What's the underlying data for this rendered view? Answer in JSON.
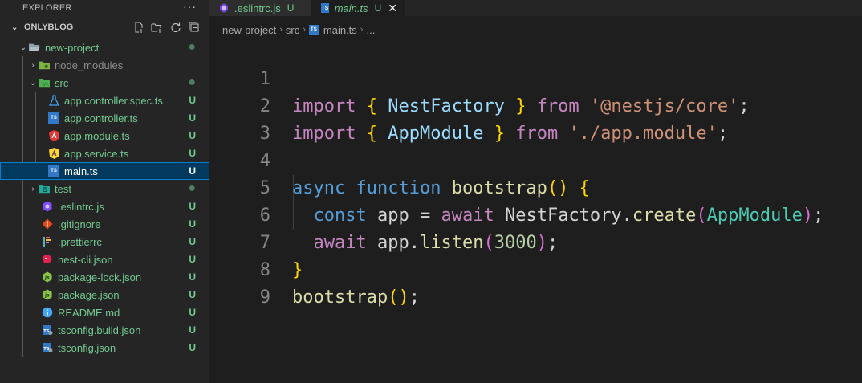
{
  "sidebar": {
    "title": "EXPLORER",
    "more_label": "···",
    "workspace": "ONLYBLOG",
    "actions": [
      "new-file-icon",
      "new-folder-icon",
      "refresh-icon",
      "collapse-all-icon"
    ],
    "items": [
      {
        "label": "new-project",
        "status": "●"
      },
      {
        "label": "node_modules",
        "status": ""
      },
      {
        "label": "src",
        "status": "●"
      },
      {
        "label": "app.controller.spec.ts",
        "status": "U"
      },
      {
        "label": "app.controller.ts",
        "status": "U"
      },
      {
        "label": "app.module.ts",
        "status": "U"
      },
      {
        "label": "app.service.ts",
        "status": "U"
      },
      {
        "label": "main.ts",
        "status": "U"
      },
      {
        "label": "test",
        "status": "●"
      },
      {
        "label": ".eslintrc.js",
        "status": "U"
      },
      {
        "label": ".gitignore",
        "status": "U"
      },
      {
        "label": ".prettierrc",
        "status": "U"
      },
      {
        "label": "nest-cli.json",
        "status": "U"
      },
      {
        "label": "package-lock.json",
        "status": "U"
      },
      {
        "label": "package.json",
        "status": "U"
      },
      {
        "label": "README.md",
        "status": "U"
      },
      {
        "label": "tsconfig.build.json",
        "status": "U"
      },
      {
        "label": "tsconfig.json",
        "status": "U"
      }
    ]
  },
  "tabs": [
    {
      "name": ".eslintrc.js",
      "status": "U",
      "icon": "eslint-icon"
    },
    {
      "name": "main.ts",
      "status": "U",
      "icon": "typescript-icon",
      "close": "✕"
    }
  ],
  "breadcrumb": {
    "parts": [
      "new-project",
      "src",
      "main.ts",
      "..."
    ]
  },
  "editor": {
    "line_numbers": [
      "1",
      "2",
      "3",
      "4",
      "5",
      "6",
      "7",
      "8",
      "9"
    ],
    "tokens": {
      "l1": [
        "import",
        "{",
        "NestFactory",
        "}",
        "from",
        "'@nestjs/core'",
        ";"
      ],
      "l2": [
        "import",
        "{",
        "AppModule",
        "}",
        "from",
        "'./app.module'",
        ";"
      ],
      "l4": [
        "async",
        "function",
        "bootstrap",
        "()",
        "{"
      ],
      "l5": [
        "const",
        "app",
        "=",
        "await",
        "NestFactory",
        ".",
        "create",
        "(",
        "AppModule",
        ")",
        ";"
      ],
      "l6": [
        "await",
        "app",
        ".",
        "listen",
        "(",
        "3000",
        ")",
        ";"
      ],
      "l7": [
        "}"
      ],
      "l8": [
        "bootstrap",
        "()",
        ";"
      ]
    }
  },
  "colors": {
    "keyword": "#c586c0",
    "storage": "#569cd6",
    "class": "#4ec9b0",
    "function": "#dcdcaa",
    "string": "#ce9178",
    "number": "#b5cea8",
    "untracked": "#73c991"
  }
}
